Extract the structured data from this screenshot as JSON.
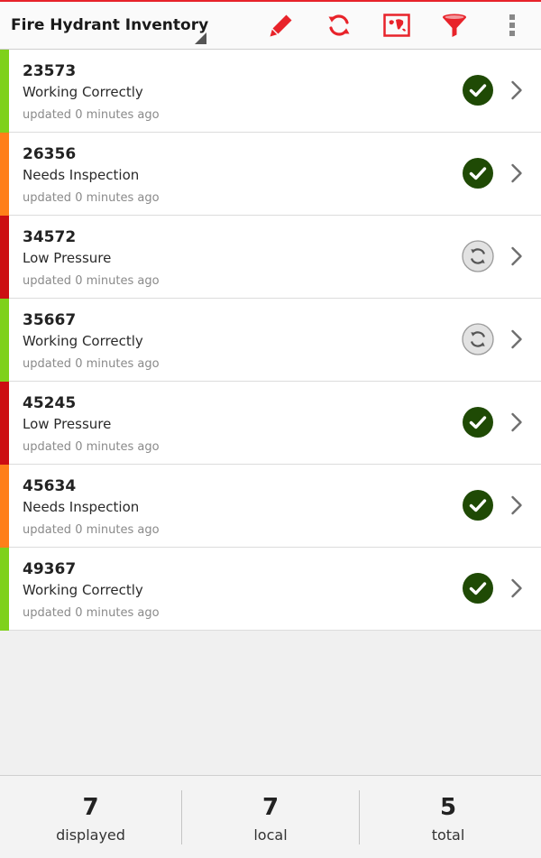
{
  "app": {
    "title": "Fire Hydrant Inventory"
  },
  "toolbar": {
    "accent_color": "#e8232a",
    "actions": [
      {
        "name": "edit-button",
        "icon": "pencil-icon"
      },
      {
        "name": "refresh-button",
        "icon": "refresh-icon"
      },
      {
        "name": "map-button",
        "icon": "map-icon"
      },
      {
        "name": "filter-button",
        "icon": "filter-icon"
      },
      {
        "name": "overflow-menu-button",
        "icon": "more-vert-icon"
      }
    ]
  },
  "status_colors": {
    "Working Correctly": "#7fd11b",
    "Needs Inspection": "#ff7f19",
    "Low Pressure": "#cc0e12"
  },
  "hydrants": [
    {
      "id": "23573",
      "status": "Working Correctly",
      "updated": "updated 0 minutes ago",
      "sync": "synced"
    },
    {
      "id": "26356",
      "status": "Needs Inspection",
      "updated": "updated 0 minutes ago",
      "sync": "synced"
    },
    {
      "id": "34572",
      "status": "Low Pressure",
      "updated": "updated 0 minutes ago",
      "sync": "pending"
    },
    {
      "id": "35667",
      "status": "Working Correctly",
      "updated": "updated 0 minutes ago",
      "sync": "pending"
    },
    {
      "id": "45245",
      "status": "Low Pressure",
      "updated": "updated 0 minutes ago",
      "sync": "synced"
    },
    {
      "id": "45634",
      "status": "Needs Inspection",
      "updated": "updated 0 minutes ago",
      "sync": "synced"
    },
    {
      "id": "49367",
      "status": "Working Correctly",
      "updated": "updated 0 minutes ago",
      "sync": "synced"
    }
  ],
  "footer": {
    "displayed": {
      "value": "7",
      "label": "displayed"
    },
    "local": {
      "value": "7",
      "label": "local"
    },
    "total": {
      "value": "5",
      "label": "total"
    }
  }
}
